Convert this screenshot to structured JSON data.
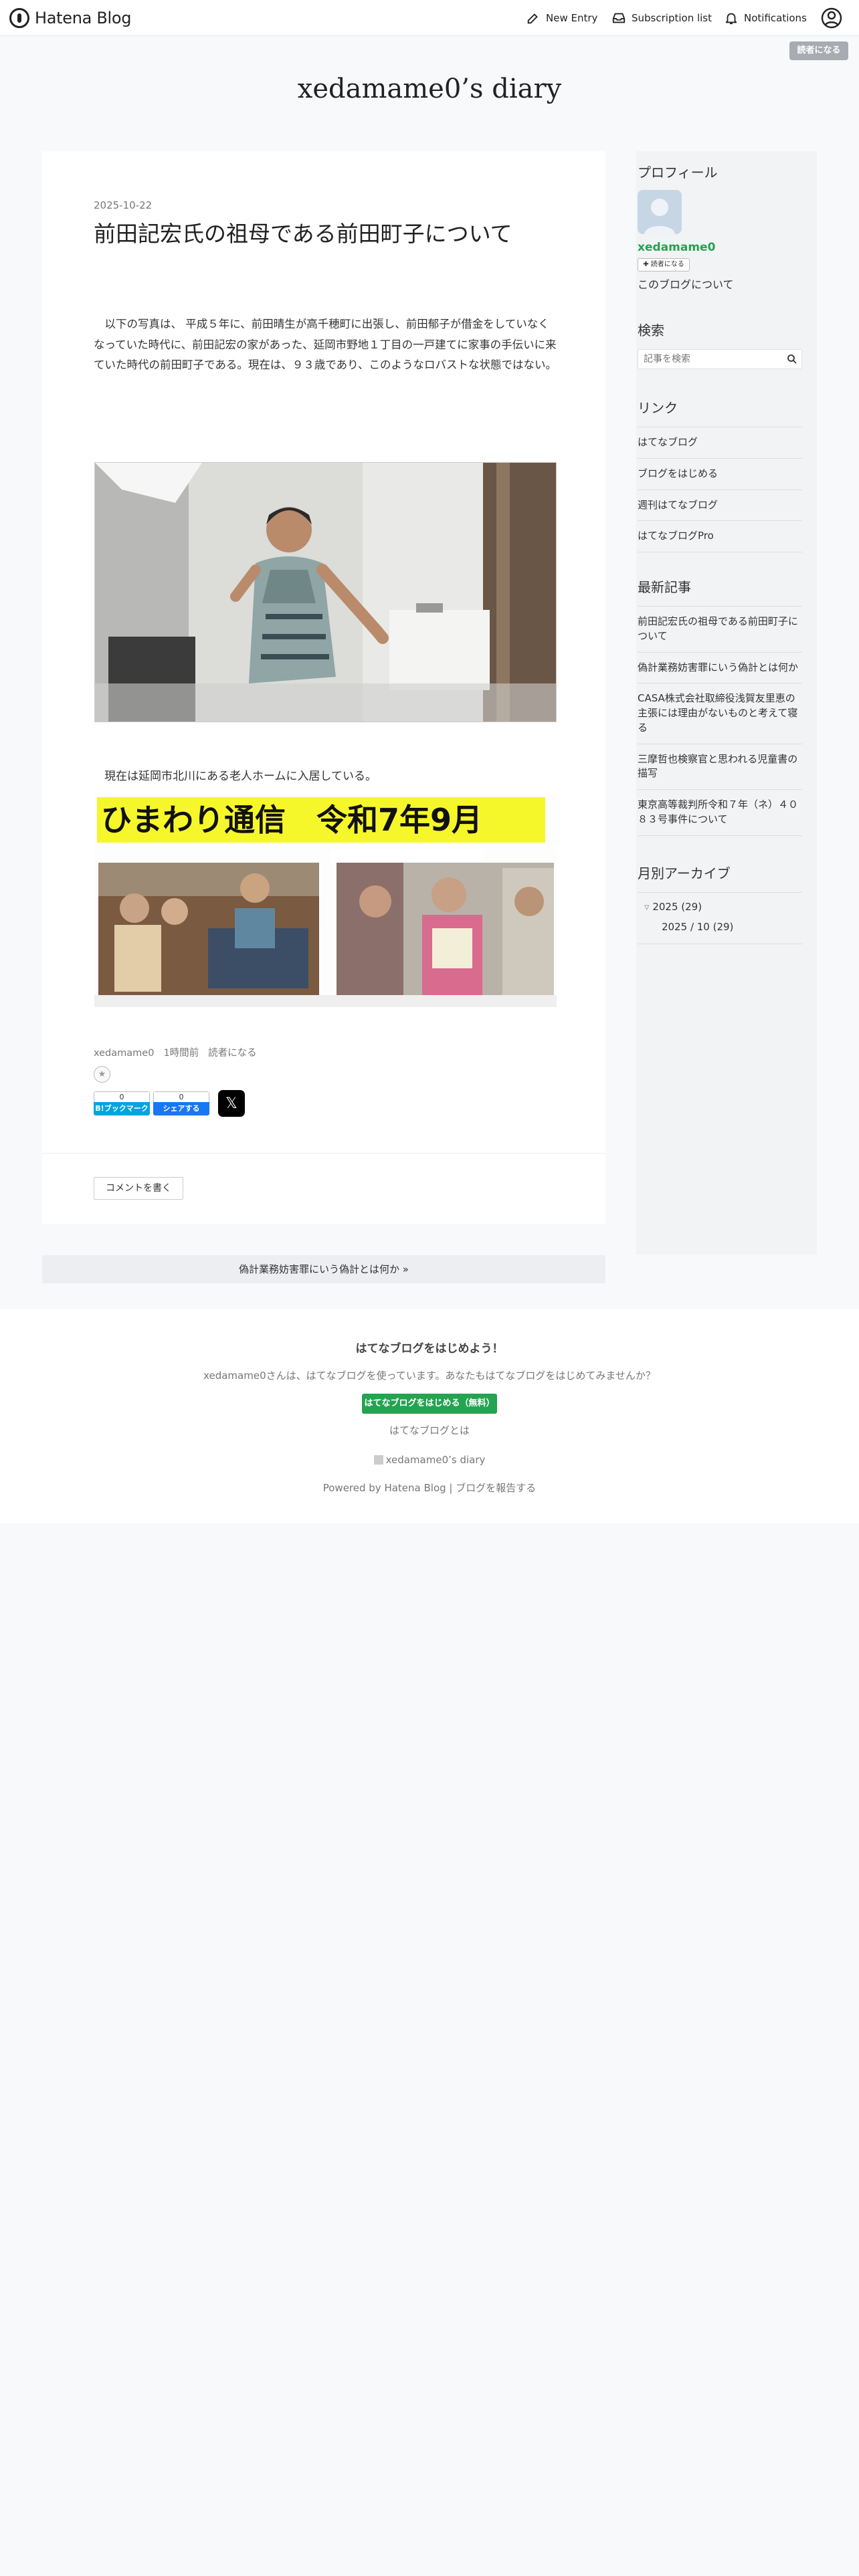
{
  "global": {
    "logo_text": "Hatena Blog",
    "nav": {
      "new_entry": "New Entry",
      "subscription": "Subscription list",
      "notifications": "Notifications"
    },
    "reader_button": "読者になる"
  },
  "blog_title": "xedamame0’s diary",
  "entry": {
    "date": "2025-10-22",
    "title": "前田記宏氏の祖母である前田町子について",
    "body": "以下の写真は、 平成５年に、前田晴生が高千穂町に出張し、前田郁子が借金をしていなくなっていた時代に、前田記宏の家があった、延岡市野地１丁目の一戸建てに家事の手伝いに来ていた時代の前田町子である。現在は、９３歳であり、このようなロバストな状態ではない。",
    "caption2": "現在は延岡市北川にある老人ホームに入居している。",
    "photo2_banner": "ひまわり通信　令和7年9月",
    "author": "xedamame0",
    "posted": "1時間前",
    "reader": "読者になる",
    "hatena_bookmark_count": "0",
    "hatena_bookmark_label": "B!ブックマーク",
    "facebook_count": "0",
    "facebook_label": "シェアする",
    "x_label": "𝕏",
    "comment_button": "コメントを書く"
  },
  "pager": {
    "next": "偽計業務妨害罪にいう偽計とは何か »"
  },
  "sidebar": {
    "profile_heading": "プロフィール",
    "profile_name": "xedamame0",
    "reader_small": "読者になる",
    "about_blog": "このブログについて",
    "search_heading": "検索",
    "search_placeholder": "記事を検索",
    "links_heading": "リンク",
    "links": [
      "はてなブログ",
      "ブログをはじめる",
      "週刊はてなブログ",
      "はてなブログPro"
    ],
    "recent_heading": "最新記事",
    "recent": [
      "前田記宏氏の祖母である前田町子について",
      "偽計業務妨害罪にいう偽計とは何か",
      "CASA株式会社取締役浅賀友里恵の主張には理由がないものと考えて寝る",
      "三摩哲也検察官と思われる児童書の描写",
      "東京高等裁判所令和７年（ネ）４０８３号事件について"
    ],
    "archive_heading": "月別アーカイブ",
    "archive_year": "2025 (29)",
    "archive_month": "2025 / 10 (29)"
  },
  "footer": {
    "heading": "はてなブログをはじめよう！",
    "text": "xedamame0さんは、はてなブログを使っています。あなたもはてなブログをはじめてみませんか？",
    "start_button": "はてなブログをはじめる（無料）",
    "about": "はてなブログとは",
    "blog_link": "xedamame0’s diary",
    "powered": "Powered by Hatena Blog | ブログを報告する"
  }
}
